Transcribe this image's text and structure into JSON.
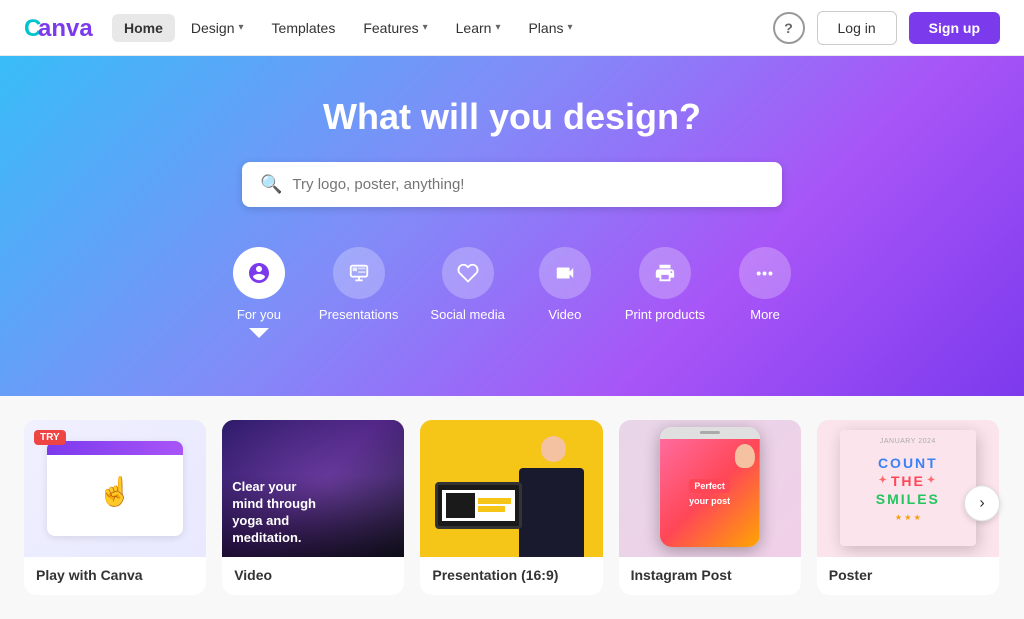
{
  "nav": {
    "logo_text": "Canva",
    "links": [
      {
        "label": "Home",
        "active": true
      },
      {
        "label": "Design",
        "has_chevron": true
      },
      {
        "label": "Templates",
        "has_chevron": false
      },
      {
        "label": "Features",
        "has_chevron": true
      },
      {
        "label": "Learn",
        "has_chevron": true
      },
      {
        "label": "Plans",
        "has_chevron": true
      }
    ],
    "help_label": "?",
    "login_label": "Log in",
    "signup_label": "Sign up"
  },
  "hero": {
    "heading": "What will you design?",
    "search_placeholder": "Try logo, poster, anything!",
    "categories": [
      {
        "label": "For you",
        "active": true,
        "icon": "✦"
      },
      {
        "label": "Presentations",
        "active": false,
        "icon": "⊞"
      },
      {
        "label": "Social media",
        "active": false,
        "icon": "♡"
      },
      {
        "label": "Video",
        "active": false,
        "icon": "▶"
      },
      {
        "label": "Print products",
        "active": false,
        "icon": "🖨"
      },
      {
        "label": "More",
        "active": false,
        "icon": "•••"
      }
    ]
  },
  "cards": [
    {
      "label": "Play with Canva",
      "badge": "TRY"
    },
    {
      "label": "Video"
    },
    {
      "label": "Presentation (16:9)"
    },
    {
      "label": "Instagram Post"
    },
    {
      "label": "Poster"
    }
  ],
  "card2": {
    "overlay_text": "Clear your\nmind through\nyoga and\nmeditation."
  },
  "card4": {
    "badge": "Perfect",
    "subtext": "your post"
  },
  "card5": {
    "line1": "COUNT",
    "line2": "THE",
    "line3": "SMILES"
  }
}
